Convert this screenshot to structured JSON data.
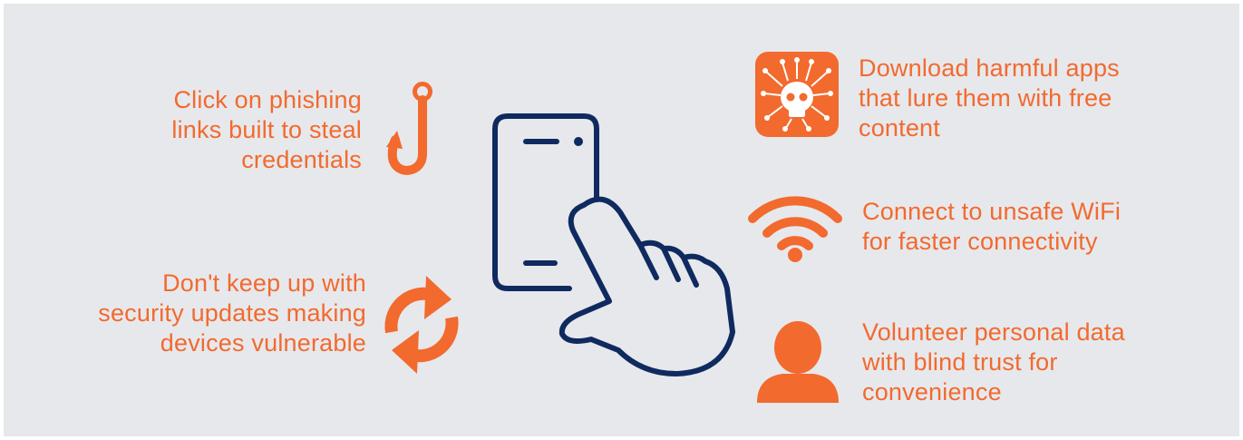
{
  "items": {
    "phishing": {
      "text": "Click on phishing\nlinks built to steal\ncredentials",
      "icon": "fishing-hook-icon"
    },
    "updates": {
      "text": "Don't keep up with\nsecurity updates making\ndevices vulnerable",
      "icon": "refresh-icon"
    },
    "apps": {
      "text": "Download harmful apps\nthat lure them with free\ncontent",
      "icon": "malware-skull-icon"
    },
    "wifi": {
      "text": "Connect to unsafe WiFi\nfor faster connectivity",
      "icon": "wifi-icon"
    },
    "personal": {
      "text": "Volunteer personal data\nwith blind trust for\nconvenience",
      "icon": "user-icon"
    }
  },
  "center_icon": "phone-tap-icon",
  "colors": {
    "accent": "#f26a2e",
    "navy": "#0f2a5f",
    "background": "#e7e8ec"
  }
}
